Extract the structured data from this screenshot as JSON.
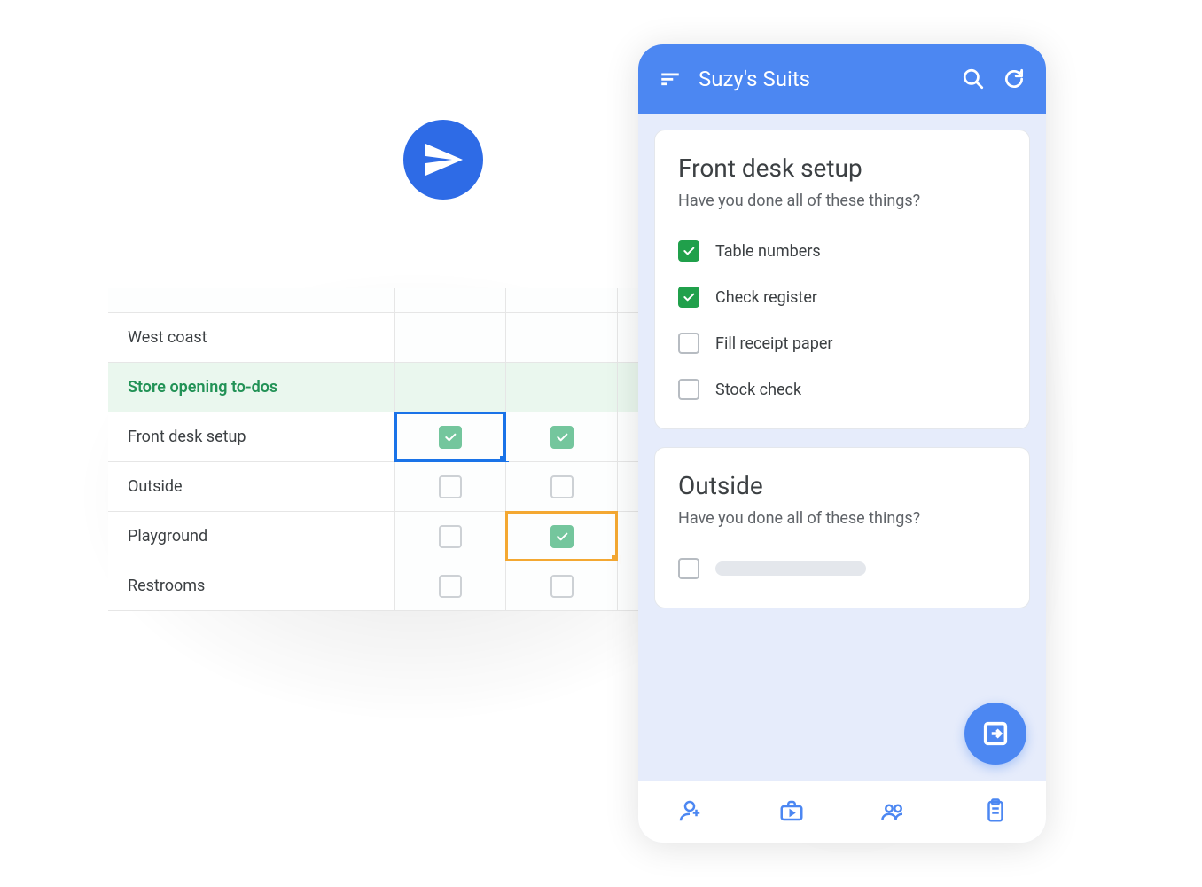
{
  "colors": {
    "primary": "#4c87f2",
    "green": "#20a04b",
    "accent_orange": "#f4a832"
  },
  "spreadsheet": {
    "region_label": "West coast",
    "section_title": "Store opening to-dos",
    "rows": [
      {
        "label": "Front desk setup",
        "col1_checked": true,
        "col2_checked": true,
        "col1_selected": "blue"
      },
      {
        "label": "Outside",
        "col1_checked": false,
        "col2_checked": false
      },
      {
        "label": "Playground",
        "col1_checked": false,
        "col2_checked": true,
        "col2_selected": "orange"
      },
      {
        "label": "Restrooms",
        "col1_checked": false,
        "col2_checked": false
      }
    ]
  },
  "phone": {
    "title": "Suzy's Suits",
    "cards": [
      {
        "title": "Front desk setup",
        "subtitle": "Have you done all of these things?",
        "tasks": [
          {
            "label": "Table numbers",
            "checked": true
          },
          {
            "label": "Check register",
            "checked": true
          },
          {
            "label": "Fill receipt paper",
            "checked": false
          },
          {
            "label": "Stock check",
            "checked": false
          }
        ]
      },
      {
        "title": "Outside",
        "subtitle": "Have you done all of these things?",
        "tasks": []
      }
    ]
  }
}
